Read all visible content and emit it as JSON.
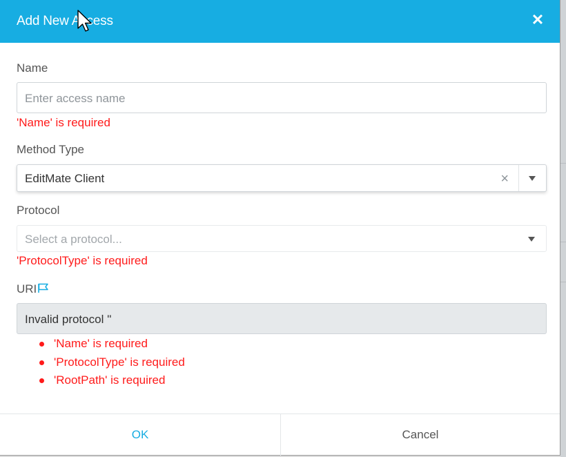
{
  "dialog": {
    "title": "Add New Access",
    "close_glyph": "✕",
    "close_icon": "close-icon"
  },
  "fields": {
    "name": {
      "label": "Name",
      "placeholder": "Enter access name",
      "value": "",
      "error": "'Name' is required"
    },
    "method_type": {
      "label": "Method Type",
      "value": "EditMate Client",
      "clear_glyph": "×"
    },
    "protocol": {
      "label": "Protocol",
      "placeholder": "Select a protocol...",
      "error": "'ProtocolType' is required"
    },
    "uri": {
      "label": "URI",
      "icon": "flag-icon",
      "value": "Invalid protocol ''"
    }
  },
  "validation_errors": [
    "'Name' is required",
    "'ProtocolType' is required",
    "'RootPath' is required"
  ],
  "footer": {
    "ok_label": "OK",
    "cancel_label": "Cancel"
  },
  "colors": {
    "header": "#17ade2",
    "error": "#ff1a1a",
    "ok_text": "#17ade2",
    "cancel_text": "#555555"
  }
}
